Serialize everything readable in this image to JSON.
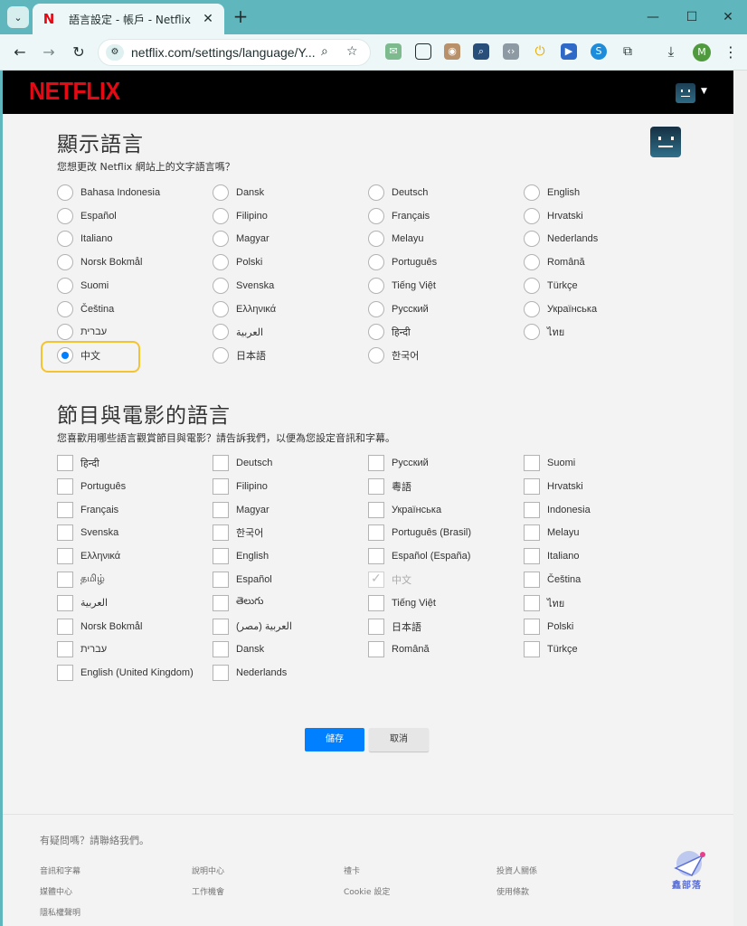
{
  "browser": {
    "tab_title": "語言設定 - 帳戶 - Netflix",
    "tab_favicon": "N",
    "url": "netflix.com/settings/language/Y...",
    "profile_initial": "M"
  },
  "header": {
    "logo": "NETFLIX"
  },
  "display_language": {
    "title": "顯示語言",
    "subtitle": "您想更改 Netflix 網站上的文字語言嗎？",
    "selected": "中文",
    "options": [
      "Bahasa Indonesia",
      "Dansk",
      "Deutsch",
      "English",
      "Español",
      "Filipino",
      "Français",
      "Hrvatski",
      "Italiano",
      "Magyar",
      "Melayu",
      "Nederlands",
      "Norsk Bokmål",
      "Polski",
      "Português",
      "Română",
      "Suomi",
      "Svenska",
      "Tiếng Việt",
      "Türkçe",
      "Čeština",
      "Ελληνικά",
      "Русский",
      "Українська",
      "עברית",
      "العربية",
      "हिन्दी",
      "ไทย",
      "中文",
      "日本語",
      "한국어"
    ]
  },
  "content_language": {
    "title": "節目與電影的語言",
    "subtitle": "您喜歡用哪些語言觀賞節目與電影？請告訴我們，以便為您設定音訊和字幕。",
    "checked": [
      "中文"
    ],
    "options": [
      "हिन्दी",
      "Deutsch",
      "Русский",
      "Suomi",
      "Português",
      "Filipino",
      "粵語",
      "Hrvatski",
      "Français",
      "Magyar",
      "Українська",
      "Indonesia",
      "Svenska",
      "한국어",
      "Português (Brasil)",
      "Melayu",
      "Ελληνικά",
      "English",
      "Español (España)",
      "Italiano",
      "தமிழ்",
      "Español",
      "中文",
      "Čeština",
      "العربية",
      "తెలుగు",
      "Tiếng Việt",
      "ไทย",
      "Norsk Bokmål",
      "(العربية (مصر",
      "日本語",
      "Polski",
      "עברית",
      "Dansk",
      "Română",
      "Türkçe",
      "English (United Kingdom)",
      "Nederlands"
    ]
  },
  "actions": {
    "save": "儲存",
    "cancel": "取消"
  },
  "footer": {
    "question": "有疑問嗎？請聯絡我們。",
    "links": [
      "音訊和字幕",
      "說明中心",
      "禮卡",
      "投資人關係",
      "媒體中心",
      "工作機會",
      "Cookie 設定",
      "使用條款",
      "隱私權聲明"
    ]
  },
  "watermark": {
    "text": "鑫部落"
  },
  "colors": {
    "netflix_red": "#e50914",
    "accent_blue": "#0080ff",
    "highlight": "#f4c430",
    "chrome_teal": "#5fb7bd"
  }
}
